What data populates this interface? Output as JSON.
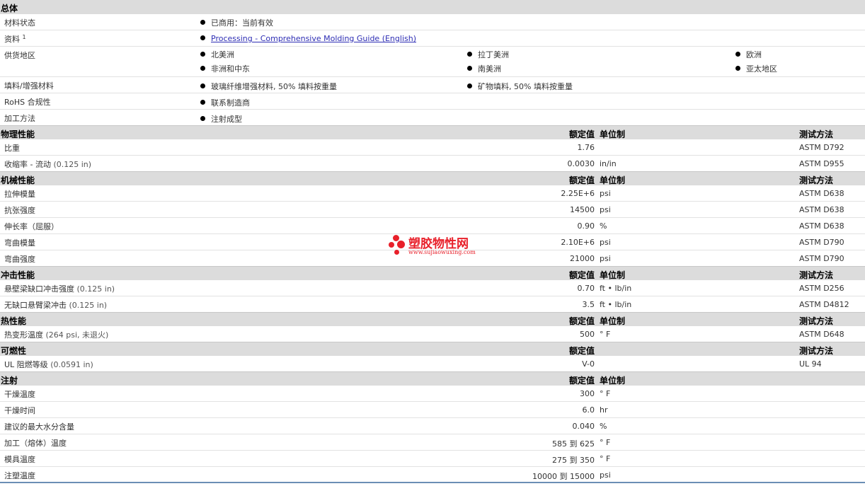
{
  "general": {
    "title": "总体",
    "material_status": {
      "label": "材料状态",
      "value": "已商用：当前有效"
    },
    "documents": {
      "label": "资料",
      "sup": "1",
      "link": "Processing - Comprehensive Molding Guide (English)"
    },
    "availability": {
      "label": "供货地区",
      "items": [
        "北美洲",
        "拉丁美洲",
        "欧洲",
        "非洲和中东",
        "南美洲",
        "亚太地区"
      ]
    },
    "filler": {
      "label": "填料/增强材料",
      "items": [
        "玻璃纤维增强材料, 50% 填料按重量",
        "矿物填料, 50% 填料按重量"
      ]
    },
    "rohs": {
      "label": "RoHS 合规性",
      "value": "联系制造商"
    },
    "processing": {
      "label": "加工方法",
      "value": "注射成型"
    }
  },
  "headers": {
    "nominal": "额定值",
    "unit": "单位制",
    "method": "测试方法"
  },
  "physical": {
    "title": "物理性能",
    "rows": [
      {
        "label": "比重",
        "cond": "",
        "value": "1.76",
        "unit": "",
        "method": "ASTM D792"
      },
      {
        "label": "收缩率 - 流动",
        "cond": "(0.125 in)",
        "value": "0.0030",
        "unit": "in/in",
        "method": "ASTM D955"
      }
    ]
  },
  "mechanical": {
    "title": "机械性能",
    "rows": [
      {
        "label": "拉伸模量",
        "cond": "",
        "value": "2.25E+6",
        "unit": "psi",
        "method": "ASTM D638"
      },
      {
        "label": "抗张强度",
        "cond": "",
        "value": "14500",
        "unit": "psi",
        "method": "ASTM D638"
      },
      {
        "label": "伸长率（屈服）",
        "cond": "",
        "value": "0.90",
        "unit": "%",
        "method": "ASTM D638"
      },
      {
        "label": "弯曲模量",
        "cond": "",
        "value": "2.10E+6",
        "unit": "psi",
        "method": "ASTM D790"
      },
      {
        "label": "弯曲强度",
        "cond": "",
        "value": "21000",
        "unit": "psi",
        "method": "ASTM D790"
      }
    ]
  },
  "impact": {
    "title": "冲击性能",
    "rows": [
      {
        "label": "悬壁梁缺口冲击强度",
        "cond": "(0.125 in)",
        "value": "0.70",
        "unit": "ft • lb/in",
        "method": "ASTM D256"
      },
      {
        "label": "无缺口悬臂梁冲击",
        "cond": "(0.125 in)",
        "value": "3.5",
        "unit": "ft • lb/in",
        "method": "ASTM D4812"
      }
    ]
  },
  "thermal": {
    "title": "热性能",
    "rows": [
      {
        "label": "热变形温度",
        "cond": "(264 psi, 未退火)",
        "value": "500",
        "unit": "° F",
        "method": "ASTM D648"
      }
    ]
  },
  "flammability": {
    "title": "可燃性",
    "rows": [
      {
        "label": "UL 阻燃等级",
        "cond": "(0.0591 in)",
        "value": "V-0",
        "unit": "",
        "method": "UL 94"
      }
    ]
  },
  "injection": {
    "title": "注射",
    "rows": [
      {
        "label": "干燥温度",
        "cond": "",
        "value": "300",
        "unit": "° F",
        "method": ""
      },
      {
        "label": "干燥时间",
        "cond": "",
        "value": "6.0",
        "unit": "hr",
        "method": ""
      },
      {
        "label": "建议的最大水分含量",
        "cond": "",
        "value": "0.040",
        "unit": "%",
        "method": ""
      },
      {
        "label": "加工（熔体）温度",
        "cond": "",
        "value": "585 到 625",
        "unit": "° F",
        "method": ""
      },
      {
        "label": "模具温度",
        "cond": "",
        "value": "275 到 350",
        "unit": "° F",
        "method": ""
      },
      {
        "label": "注塑温度",
        "cond": "",
        "value": "10000 到 15000",
        "unit": "psi",
        "method": ""
      }
    ]
  },
  "watermark": {
    "text": "塑胶物性网",
    "url": "www.sujiaowuxing.com",
    "color": "#e8202a"
  }
}
